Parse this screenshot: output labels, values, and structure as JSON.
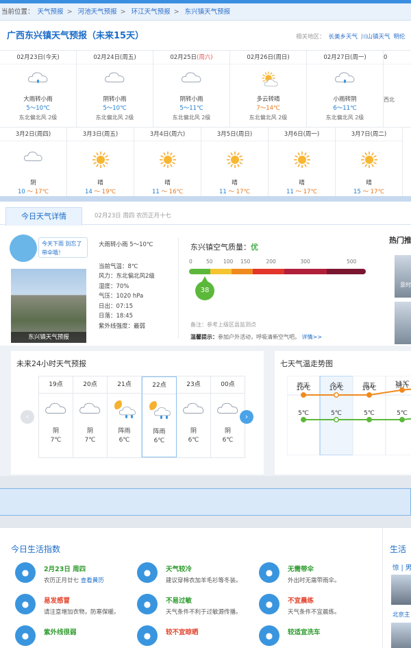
{
  "breadcrumb": {
    "prefix": "当前位置：",
    "items": [
      "天气预报",
      "河池天气预报",
      "环江天气预报",
      "东兴镇天气预报"
    ],
    "sep": ">"
  },
  "header": {
    "title": "广西东兴镇天气预报（未来15天）",
    "related_label": "相关地区：",
    "related": [
      "长美乡天气",
      "川山镇天气",
      "明伦"
    ]
  },
  "forecast_row1": [
    {
      "date": "02月23日",
      "weekday": "(今天)",
      "desc": "大雨转小雨",
      "temp": "5～10℃",
      "wind": "东北偏北风 2级",
      "icon": "rain-cloud-icon",
      "warm": false
    },
    {
      "date": "02月24日",
      "weekday": "(周五)",
      "desc": "阴转小雨",
      "temp": "5～10℃",
      "wind": "东北偏北风 2级",
      "icon": "cloudy-icon",
      "warm": false
    },
    {
      "date": "02月25日",
      "weekday": "(周六)",
      "desc": "阴转小雨",
      "temp": "5～11℃",
      "wind": "东北偏北风 2级",
      "icon": "cloudy-icon",
      "warm": false
    },
    {
      "date": "02月26日",
      "weekday": "(周日)",
      "desc": "多云转晴",
      "temp": "7～14℃",
      "wind": "东北偏北风 2级",
      "icon": "sun-cloud-icon",
      "warm": true
    },
    {
      "date": "02月27日",
      "weekday": "(周一)",
      "desc": "小雨转阴",
      "temp": "6～11℃",
      "wind": "东北偏北风 2级",
      "icon": "rain-cloud-icon",
      "warm": false
    },
    {
      "date": "0",
      "weekday": "",
      "desc": "",
      "temp": "",
      "wind": "西北",
      "icon": "",
      "warm": false
    }
  ],
  "forecast_row2": [
    {
      "date": "3月2日",
      "weekday": "(周四)",
      "desc": "阴",
      "lo": "10",
      "hi": "17℃",
      "icon": "cloudy-icon"
    },
    {
      "date": "3月3日",
      "weekday": "(周五)",
      "desc": "晴",
      "lo": "14",
      "hi": "19℃",
      "icon": "sun-icon"
    },
    {
      "date": "3月4日",
      "weekday": "(周六)",
      "desc": "晴",
      "lo": "11",
      "hi": "16℃",
      "icon": "sun-icon"
    },
    {
      "date": "3月5日",
      "weekday": "(周日)",
      "desc": "晴",
      "lo": "11",
      "hi": "17℃",
      "icon": "sun-icon"
    },
    {
      "date": "3月6日",
      "weekday": "(周一)",
      "desc": "晴",
      "lo": "11",
      "hi": "17℃",
      "icon": "sun-icon"
    },
    {
      "date": "3月7日",
      "weekday": "(周二)",
      "desc": "晴",
      "lo": "15",
      "hi": "17℃",
      "icon": "sun-icon"
    }
  ],
  "detail": {
    "tab_label": "今日天气详情",
    "tab_date": "02月23日 周四 农历正月十七",
    "bubble_text": "今天下雨 别忘了带伞哦！",
    "photo_caption": "东兴镇天气预报",
    "current_summary": "大雨转小雨 5～10℃",
    "current": [
      "当前气温：8℃",
      "风力：东北偏北风2级",
      "湿度：70%",
      "气压：1020 hPa",
      "日出：07:15",
      "日落：18:45",
      "紫外线强度：最弱"
    ],
    "aqi_title": "东兴镇空气质量：",
    "aqi_quality": "优",
    "aqi_value": "38",
    "aqi_ticks": [
      "0",
      "50",
      "100",
      "150",
      "200",
      "300",
      "500"
    ],
    "aqi_colors": [
      "#5cb83a",
      "#f5c431",
      "#f08a1e",
      "#e2362a",
      "#b0203a",
      "#7a1630"
    ],
    "aqi_note": "备注：参考上级区县监测点",
    "aqi_tip_label": "温馨提示：",
    "aqi_tip_text": "参加户外活动，呼吸清新空气吧。",
    "aqi_tip_link": "详情>>",
    "hot_title": "热门推",
    "hot_caption": "意时"
  },
  "hourly": {
    "title": "未来24小时天气预报",
    "items": [
      {
        "time": "19点",
        "desc": "阴",
        "temp": "7℃",
        "icon": "cloudy-icon"
      },
      {
        "time": "20点",
        "desc": "阴",
        "temp": "7℃",
        "icon": "cloudy-icon"
      },
      {
        "time": "21点",
        "desc": "阵雨",
        "temp": "6℃",
        "icon": "moon-rain-icon"
      },
      {
        "time": "22点",
        "desc": "阵雨",
        "temp": "6℃",
        "icon": "moon-rain-icon"
      },
      {
        "time": "23点",
        "desc": "阴",
        "temp": "6℃",
        "icon": "cloudy-icon"
      },
      {
        "time": "00点",
        "desc": "阴",
        "temp": "6℃",
        "icon": "cloudy-icon"
      }
    ]
  },
  "weekly": {
    "title": "七天气温走势图",
    "days": [
      "昨天",
      "今天",
      "周五",
      "周六"
    ],
    "hi": [
      10,
      10,
      10,
      11
    ],
    "lo": [
      5,
      5,
      5,
      5
    ],
    "hi_labels": [
      "10℃",
      "10℃",
      "10℃",
      "11℃"
    ],
    "lo_labels": [
      "5℃",
      "5℃",
      "5℃",
      "5℃"
    ],
    "hi_color": "#f08a1e",
    "lo_color": "#5cb83a"
  },
  "life": {
    "title": "今日生活指数",
    "items": [
      {
        "head": "2月23日 周四",
        "text": "农历正月廿七",
        "link": "查看黄历",
        "icon": "calendar-icon",
        "red": false
      },
      {
        "head": "天气较冷",
        "text": "建议穿棉衣加羊毛衫等冬装。",
        "link": "",
        "icon": "shirt-icon",
        "red": false
      },
      {
        "head": "无需带伞",
        "text": "外出时无需带雨伞。",
        "link": "",
        "icon": "umbrella-icon",
        "red": false
      },
      {
        "head": "易发感冒",
        "text": "请注意增加衣物，防寒保暖。",
        "link": "",
        "icon": "mask-icon",
        "red": true
      },
      {
        "head": "不易过敏",
        "text": "天气条件不利于过敏源传播。",
        "link": "",
        "icon": "pill-icon",
        "red": false
      },
      {
        "head": "不宜晨练",
        "text": "天气条件不宜晨练。",
        "link": "",
        "icon": "runner-icon",
        "red": true
      },
      {
        "head": "紫外线很弱",
        "text": "",
        "link": "",
        "icon": "sun-small-icon",
        "red": false
      },
      {
        "head": "较不宜晾晒",
        "text": "",
        "link": "",
        "icon": "laundry-icon",
        "red": true
      },
      {
        "head": "较适宜洗车",
        "text": "",
        "link": "",
        "icon": "car-icon",
        "red": false
      }
    ],
    "side_title": "生活",
    "side_sub": "惊 | 男",
    "side_sub2": "北京主"
  }
}
